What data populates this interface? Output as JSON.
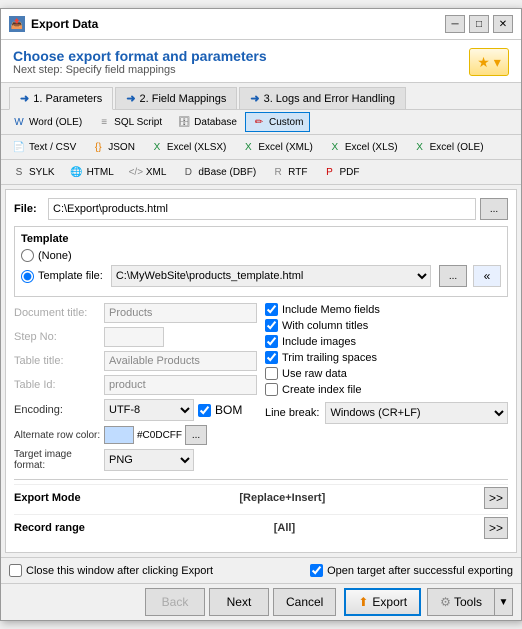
{
  "window": {
    "title": "Export Data",
    "header_title": "Choose export format and parameters",
    "header_subtitle": "Next step: Specify field mappings"
  },
  "tabs_top": {
    "items": [
      {
        "label": "1. Parameters",
        "active": true
      },
      {
        "label": "2. Field Mappings",
        "active": false
      },
      {
        "label": "3. Logs and Error Handling",
        "active": false
      }
    ]
  },
  "toolbar": {
    "rows": [
      [
        {
          "label": "Word (OLE)",
          "icon": "W"
        },
        {
          "label": "SQL Script",
          "icon": "S"
        },
        {
          "label": "Database",
          "icon": "D"
        },
        {
          "label": "Custom",
          "icon": "✏",
          "active": true
        }
      ],
      [
        {
          "label": "Text / CSV",
          "icon": "T"
        },
        {
          "label": "JSON",
          "icon": "J"
        },
        {
          "label": "Excel (XLSX)",
          "icon": "X"
        },
        {
          "label": "Excel (XML)",
          "icon": "X"
        },
        {
          "label": "Excel (XLS)",
          "icon": "X"
        },
        {
          "label": "Excel (OLE)",
          "icon": "X"
        }
      ],
      [
        {
          "label": "SYLK",
          "icon": "S"
        },
        {
          "label": "HTML",
          "icon": "H"
        },
        {
          "label": "XML",
          "icon": "X"
        },
        {
          "label": "dBase (DBF)",
          "icon": "D"
        },
        {
          "label": "RTF",
          "icon": "R"
        },
        {
          "label": "PDF",
          "icon": "P"
        }
      ]
    ]
  },
  "form": {
    "file_label": "File:",
    "file_value": "C:\\Export\\products.html",
    "template_label": "Template",
    "template_none_label": "(None)",
    "template_file_label": "Template file:",
    "template_file_value": "C:\\MyWebSite\\products_template.html",
    "doc_title_label": "Document title:",
    "doc_title_value": "Products",
    "step_no_label": "Step No:",
    "step_no_value": "",
    "table_title_label": "Table title:",
    "table_title_value": "Available Products",
    "table_id_label": "Table Id:",
    "table_id_value": "product",
    "encoding_label": "Encoding:",
    "encoding_value": "UTF-8",
    "bom_label": "BOM",
    "alt_row_label": "Alternate row color:",
    "alt_row_color": "#C0DCFF",
    "alt_row_color_display": "#C0DCFF",
    "target_img_label": "Target image format:",
    "target_img_value": "PNG",
    "checkboxes": {
      "include_memo": {
        "label": "Include Memo fields",
        "checked": true
      },
      "with_column_titles": {
        "label": "With column titles",
        "checked": true
      },
      "include_images": {
        "label": "Include images",
        "checked": true
      },
      "trim_trailing": {
        "label": "Trim trailing spaces",
        "checked": true
      },
      "use_raw": {
        "label": "Use raw data",
        "checked": false
      },
      "create_index": {
        "label": "Create index file",
        "checked": false
      }
    },
    "line_break_label": "Line break:",
    "line_break_value": "Windows (CR+LF)",
    "export_mode_label": "Export Mode",
    "export_mode_value": "[Replace+Insert]",
    "record_range_label": "Record range",
    "record_range_value": "[All]"
  },
  "bottom_bar": {
    "close_after_label": "Close this window after clicking Export",
    "close_after_checked": false,
    "open_target_label": "Open target after successful exporting",
    "open_target_checked": true
  },
  "buttons": {
    "back": "Back",
    "next": "Next",
    "cancel": "Cancel",
    "export": "Export",
    "tools": "Tools"
  }
}
